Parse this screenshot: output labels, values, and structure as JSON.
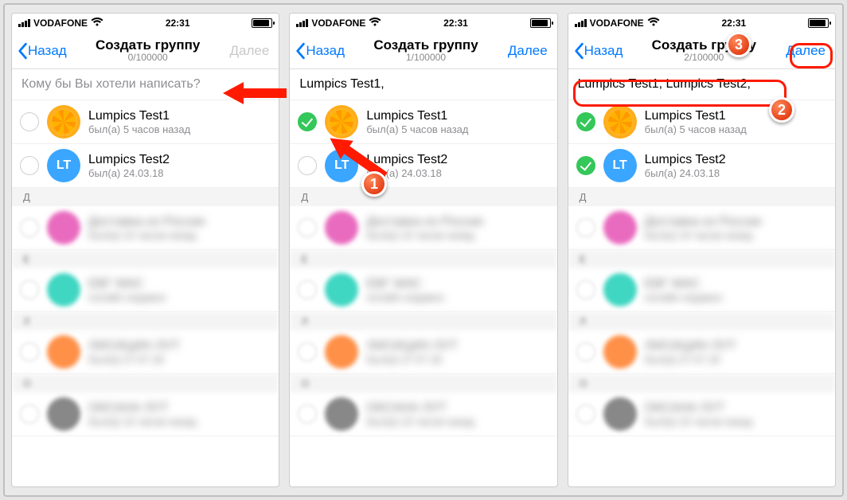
{
  "status": {
    "carrier": "VODAFONE",
    "time": "22:31"
  },
  "screens": [
    {
      "back": "Назад",
      "title": "Создать группу",
      "counter": "0/100000",
      "next": "Далее",
      "nextActive": false,
      "searchPlaceholder": "Кому бы Вы хотели написать?",
      "searchTokens": "",
      "contacts": [
        {
          "name": "Lumpics Test1",
          "sub": "был(а) 5 часов назад",
          "checked": false,
          "avatar": "orange",
          "initials": ""
        },
        {
          "name": "Lumpics Test2",
          "sub": "был(а) 24.03.18",
          "checked": false,
          "avatar": "blue",
          "initials": "LT"
        }
      ],
      "sectionLetter": "Д"
    },
    {
      "back": "Назад",
      "title": "Создать группу",
      "counter": "1/100000",
      "next": "Далее",
      "nextActive": true,
      "searchPlaceholder": "",
      "searchTokens": "Lumpics Test1,",
      "contacts": [
        {
          "name": "Lumpics Test1",
          "sub": "был(а) 5 часов назад",
          "checked": true,
          "avatar": "orange",
          "initials": ""
        },
        {
          "name": "Lumpics Test2",
          "sub": "был(а) 24.03.18",
          "checked": false,
          "avatar": "blue",
          "initials": "LT"
        }
      ],
      "sectionLetter": "Д"
    },
    {
      "back": "Назад",
      "title": "Создать группу",
      "counter": "2/100000",
      "next": "Далее",
      "nextActive": true,
      "searchPlaceholder": "",
      "searchTokens": "Lumpics Test1,  Lumpics Test2,",
      "contacts": [
        {
          "name": "Lumpics Test1",
          "sub": "был(а) 5 часов назад",
          "checked": true,
          "avatar": "orange",
          "initials": ""
        },
        {
          "name": "Lumpics Test2",
          "sub": "был(а) 24.03.18",
          "checked": true,
          "avatar": "blue",
          "initials": "LT"
        }
      ],
      "sectionLetter": "Д"
    }
  ],
  "badges": {
    "one": "1",
    "two": "2",
    "three": "3"
  }
}
